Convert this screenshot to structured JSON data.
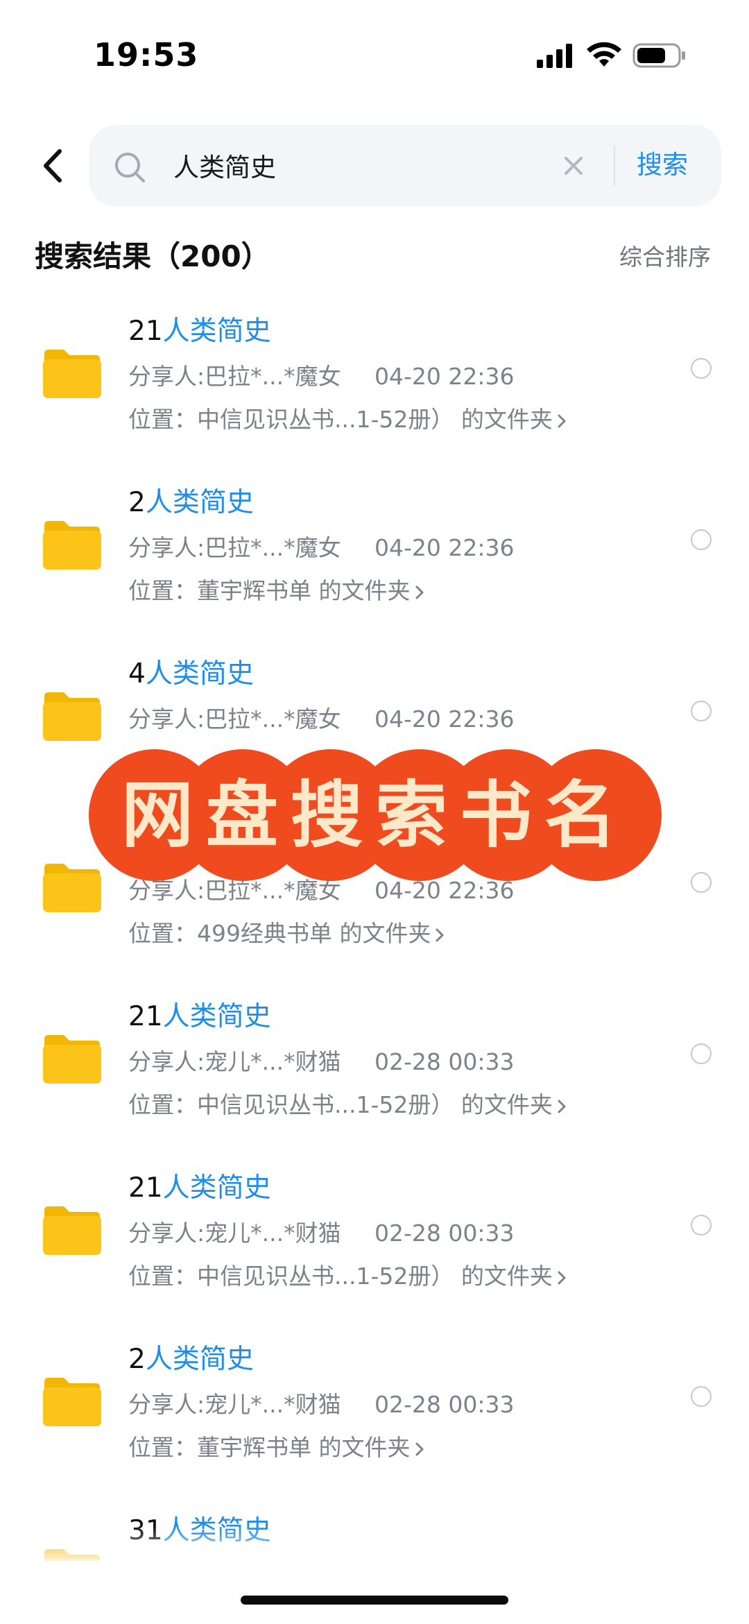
{
  "status_bar": {
    "time": "19:53"
  },
  "search": {
    "query": "人类简史",
    "button_label": "搜索"
  },
  "results": {
    "title": "搜索结果（200）",
    "sort_label": "综合排序",
    "items": [
      {
        "prefix": "21",
        "highlight": "人类简史",
        "sharer": "分享人:巴拉*...*魔女",
        "date": "04-20 22:36",
        "location": "位置：中信见识丛书...1-52册）  的文件夹"
      },
      {
        "prefix": "2",
        "highlight": "人类简史",
        "sharer": "分享人:巴拉*...*魔女",
        "date": "04-20 22:36",
        "location": "位置：董宇辉书单 的文件夹"
      },
      {
        "prefix": "4",
        "highlight": "人类简史",
        "sharer": "分享人:巴拉*...*魔女",
        "date": "04-20 22:36",
        "location": ""
      },
      {
        "prefix": "",
        "highlight": "",
        "sharer": "分享人:巴拉*...*魔女",
        "date": "04-20 22:36",
        "location": "位置：499经典书单 的文件夹"
      },
      {
        "prefix": "21",
        "highlight": "人类简史",
        "sharer": "分享人:宠儿*...*财猫",
        "date": "02-28 00:33",
        "location": "位置：中信见识丛书...1-52册）  的文件夹"
      },
      {
        "prefix": "21",
        "highlight": "人类简史",
        "sharer": "分享人:宠儿*...*财猫",
        "date": "02-28 00:33",
        "location": "位置：中信见识丛书...1-52册）  的文件夹"
      },
      {
        "prefix": "2",
        "highlight": "人类简史",
        "sharer": "分享人:宠儿*...*财猫",
        "date": "02-28 00:33",
        "location": "位置：董宇辉书单 的文件夹"
      },
      {
        "prefix": "31",
        "highlight": "人类简史",
        "sharer": "",
        "date": "",
        "location": ""
      }
    ]
  },
  "banner": {
    "text": "网盘搜索书名",
    "color": "#f04a1f"
  },
  "colors": {
    "accent": "#1e8ee8",
    "folder": "#fcc419"
  }
}
